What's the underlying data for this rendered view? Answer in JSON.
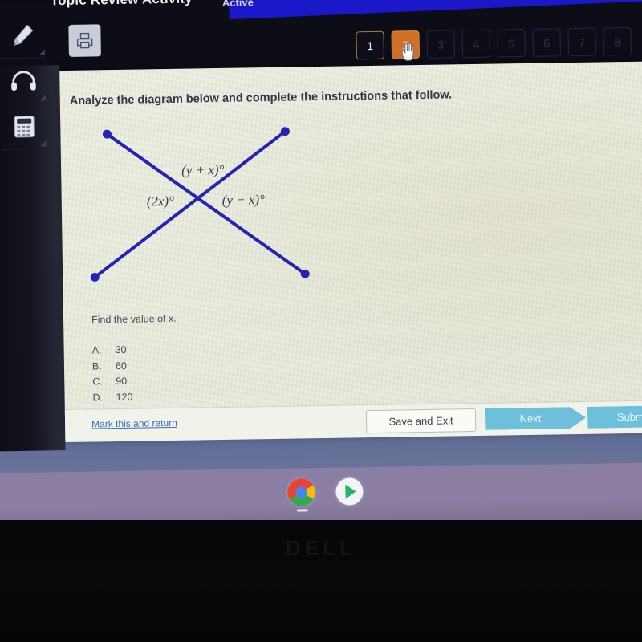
{
  "app": {
    "title": "Topic Review Activity",
    "status": "Active"
  },
  "tools": [
    {
      "name": "pencil-tool",
      "label": "Pencil"
    },
    {
      "name": "headphones-tool",
      "label": "Headphones"
    },
    {
      "name": "calculator-tool",
      "label": "Calculator"
    }
  ],
  "toolbar": {
    "print_icon": "printer-icon"
  },
  "pagination": {
    "pages": [
      "1",
      "2",
      "3",
      "4",
      "5",
      "6",
      "7",
      "8"
    ],
    "current": "1",
    "hovered": "2",
    "active_color": "#cf7029",
    "current_border_color": "#b07a3c",
    "cursor": "pointing-hand-cursor"
  },
  "question": {
    "prompt": "Analyze the diagram below and complete the instructions that follow.",
    "text": "Find the value of x.",
    "choices": [
      {
        "letter": "A.",
        "value": "30"
      },
      {
        "letter": "B.",
        "value": "60"
      },
      {
        "letter": "C.",
        "value": "90"
      },
      {
        "letter": "D.",
        "value": "120"
      }
    ]
  },
  "diagram": {
    "type": "two-intersecting-lines",
    "line_color": "#2323b4",
    "labels": {
      "top": "(y + x)°",
      "left": "(2x)°",
      "right": "(y − x)°"
    }
  },
  "footer": {
    "mark_link": "Mark this and return",
    "save_button": "Save and Exit",
    "next_button": "Next",
    "submit_button": "Submit"
  },
  "desktop": {
    "shelf_icons": [
      {
        "name": "chrome-icon",
        "label": "Google Chrome"
      },
      {
        "name": "play-store-icon",
        "label": "Google Play Store"
      }
    ]
  },
  "device": {
    "brand": "DELL"
  }
}
